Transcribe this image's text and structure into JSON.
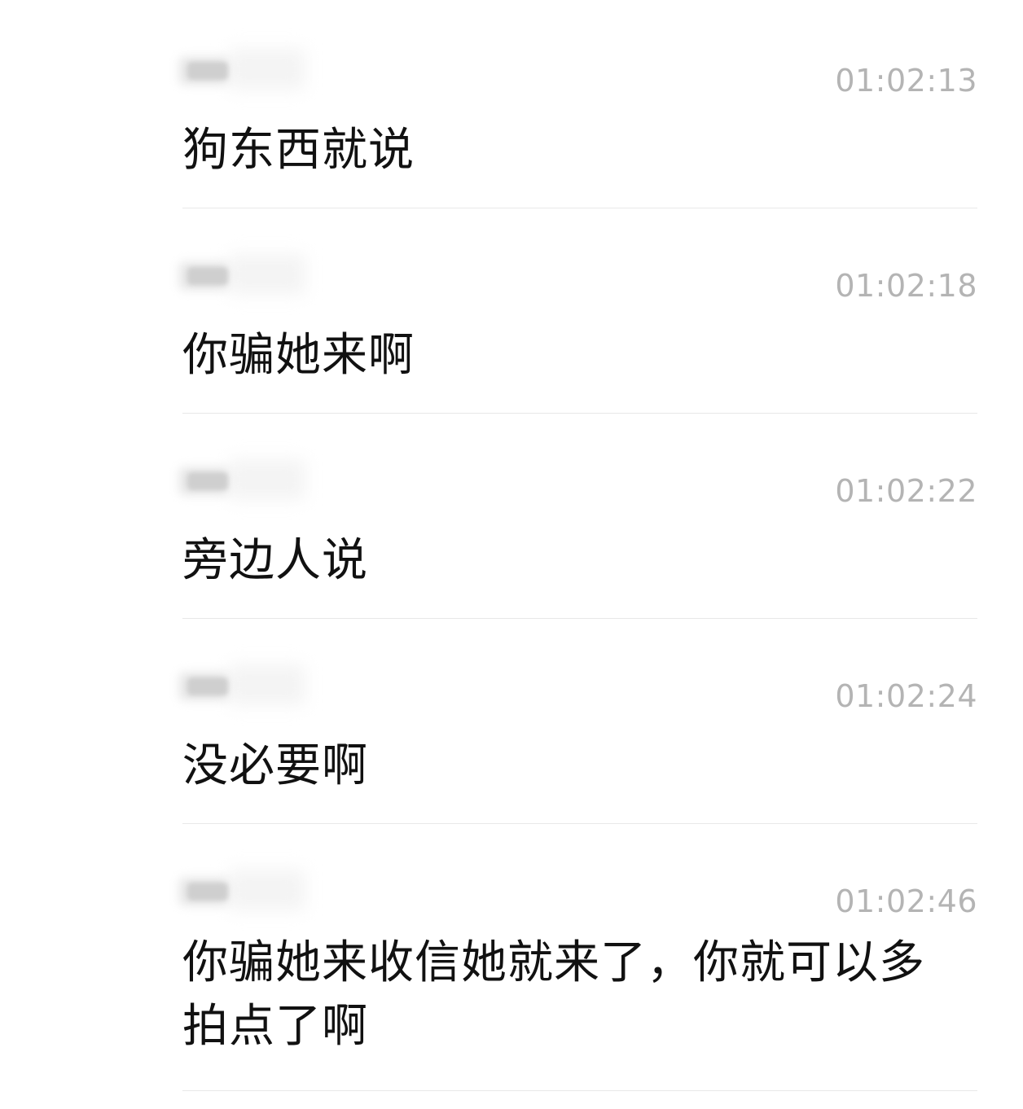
{
  "messages": [
    {
      "time": "01:02:13",
      "text": "狗东西就说"
    },
    {
      "time": "01:02:18",
      "text": "你骗她来啊"
    },
    {
      "time": "01:02:22",
      "text": "旁边人说"
    },
    {
      "time": "01:02:24",
      "text": "没必要啊"
    },
    {
      "time": "01:02:46",
      "text": "你骗她来收信她就来了，你就可以多拍点了啊"
    }
  ]
}
